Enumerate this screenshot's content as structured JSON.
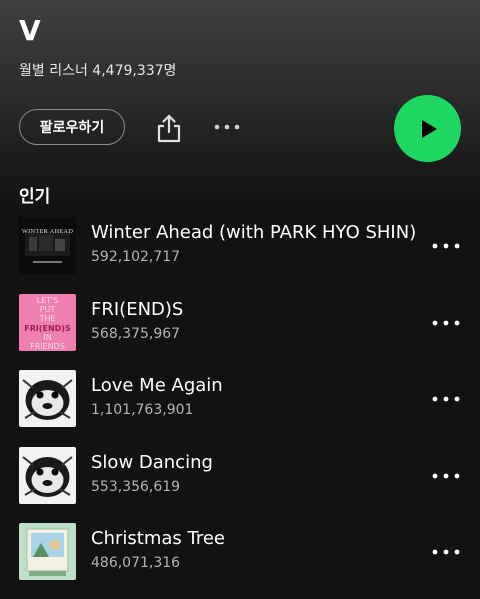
{
  "artist": {
    "name": "V",
    "monthly_listeners": "월별 리스너 4,479,337명"
  },
  "actions": {
    "follow_label": "팔로우하기",
    "share_icon": "share-icon",
    "more_icon": "more-horizontal-icon",
    "play_icon": "play-icon",
    "accent_color": "#1ed760"
  },
  "popular": {
    "title": "인기",
    "tracks": [
      {
        "title": "Winter Ahead (with PARK HYO SHIN)",
        "plays": "592,102,717",
        "cover_text": "WINTER AHEAD"
      },
      {
        "title": "FRI(END)S",
        "plays": "568,375,967",
        "cover_text": [
          "LET'S",
          "PUT",
          "THE",
          "FRI(END)S",
          "IN",
          "FRIENDS"
        ]
      },
      {
        "title": "Love Me Again",
        "plays": "1,101,763,901"
      },
      {
        "title": "Slow Dancing",
        "plays": "553,356,619"
      },
      {
        "title": "Christmas Tree",
        "plays": "486,071,316"
      }
    ]
  }
}
